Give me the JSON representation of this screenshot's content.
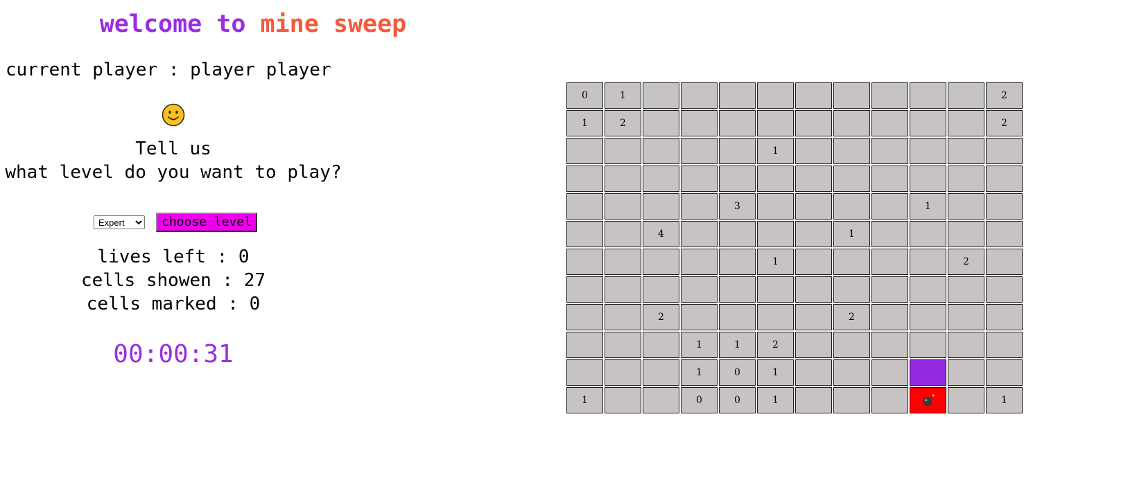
{
  "header": {
    "title_part1": "welcome to",
    "title_part2": "mine sweep"
  },
  "player": {
    "label": "current player : player player"
  },
  "status_face": {
    "icon": "smiley-face-icon"
  },
  "prompt": {
    "line1": "Tell us",
    "line2": "what level do you want to play?"
  },
  "level": {
    "selected": "Expert",
    "button_label": "choose level"
  },
  "stats": {
    "lives_left": "lives left : 0",
    "cells_shown": "cells showen : 27",
    "cells_marked": "cells marked : 0"
  },
  "timer": {
    "value": "00:00:31"
  },
  "colors": {
    "title_purple": "#9b2de0",
    "title_orange": "#f45a3c",
    "button_magenta": "#ee00ee",
    "cell_gray": "#c6c3c2",
    "marked_purple": "#9228e0",
    "exploded_red": "#ff0000"
  },
  "board": {
    "rows": [
      [
        "0",
        "1",
        "",
        "",
        "",
        "",
        "",
        "",
        "",
        "",
        "",
        "2"
      ],
      [
        "1",
        "2",
        "",
        "",
        "",
        "",
        "",
        "",
        "",
        "",
        "",
        "2"
      ],
      [
        "",
        "",
        "",
        "",
        "",
        "1",
        "",
        "",
        "",
        "",
        "",
        ""
      ],
      [
        "",
        "",
        "",
        "",
        "",
        "",
        "",
        "",
        "",
        "",
        "",
        ""
      ],
      [
        "",
        "",
        "",
        "",
        "3",
        "",
        "",
        "",
        "",
        "1",
        "",
        ""
      ],
      [
        "",
        "",
        "4",
        "",
        "",
        "",
        "",
        "1",
        "",
        "",
        "",
        ""
      ],
      [
        "",
        "",
        "",
        "",
        "",
        "1",
        "",
        "",
        "",
        "",
        "2",
        ""
      ],
      [
        "",
        "",
        "",
        "",
        "",
        "",
        "",
        "",
        "",
        "",
        "",
        ""
      ],
      [
        "",
        "",
        "2",
        "",
        "",
        "",
        "",
        "2",
        "",
        "",
        "",
        ""
      ],
      [
        "",
        "",
        "",
        "1",
        "1",
        "2",
        "",
        "",
        "",
        "",
        "",
        ""
      ],
      [
        "",
        "",
        "",
        "1",
        "0",
        "1",
        "",
        "",
        "",
        "#marked",
        "",
        ""
      ],
      [
        "1",
        "",
        "",
        "0",
        "0",
        "1",
        "",
        "",
        "",
        "#bomb",
        "",
        "1"
      ]
    ]
  }
}
